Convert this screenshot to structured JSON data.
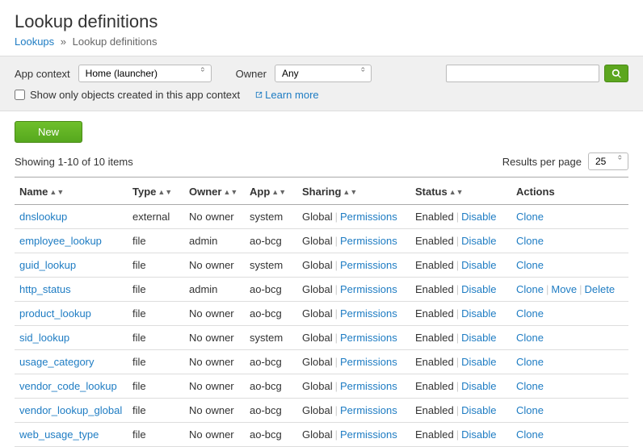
{
  "header": {
    "title": "Lookup definitions",
    "breadcrumb_link": "Lookups",
    "breadcrumb_sep": "»",
    "breadcrumb_current": "Lookup definitions"
  },
  "filterbar": {
    "app_context_label": "App context",
    "app_context_value": "Home (launcher)",
    "owner_label": "Owner",
    "owner_value": "Any",
    "search_placeholder": "",
    "checkbox_label": "Show only objects created in this app context",
    "learn_more": "Learn more"
  },
  "toolbar": {
    "new_label": "New"
  },
  "pager": {
    "showing": "Showing 1-10 of 10 items",
    "rpp_label": "Results per page",
    "rpp_value": "25"
  },
  "columns": {
    "name": "Name",
    "type": "Type",
    "owner": "Owner",
    "app": "App",
    "sharing": "Sharing",
    "status": "Status",
    "actions": "Actions"
  },
  "labels": {
    "permissions": "Permissions",
    "disable": "Disable",
    "clone": "Clone",
    "move": "Move",
    "delete": "Delete"
  },
  "rows": [
    {
      "name": "dnslookup",
      "type": "external",
      "owner": "No owner",
      "app": "system",
      "sharing": "Global",
      "status": "Enabled",
      "actions": [
        "clone"
      ]
    },
    {
      "name": "employee_lookup",
      "type": "file",
      "owner": "admin",
      "app": "ao-bcg",
      "sharing": "Global",
      "status": "Enabled",
      "actions": [
        "clone"
      ]
    },
    {
      "name": "guid_lookup",
      "type": "file",
      "owner": "No owner",
      "app": "system",
      "sharing": "Global",
      "status": "Enabled",
      "actions": [
        "clone"
      ]
    },
    {
      "name": "http_status",
      "type": "file",
      "owner": "admin",
      "app": "ao-bcg",
      "sharing": "Global",
      "status": "Enabled",
      "actions": [
        "clone",
        "move",
        "delete"
      ]
    },
    {
      "name": "product_lookup",
      "type": "file",
      "owner": "No owner",
      "app": "ao-bcg",
      "sharing": "Global",
      "status": "Enabled",
      "actions": [
        "clone"
      ]
    },
    {
      "name": "sid_lookup",
      "type": "file",
      "owner": "No owner",
      "app": "system",
      "sharing": "Global",
      "status": "Enabled",
      "actions": [
        "clone"
      ]
    },
    {
      "name": "usage_category",
      "type": "file",
      "owner": "No owner",
      "app": "ao-bcg",
      "sharing": "Global",
      "status": "Enabled",
      "actions": [
        "clone"
      ]
    },
    {
      "name": "vendor_code_lookup",
      "type": "file",
      "owner": "No owner",
      "app": "ao-bcg",
      "sharing": "Global",
      "status": "Enabled",
      "actions": [
        "clone"
      ]
    },
    {
      "name": "vendor_lookup_global",
      "type": "file",
      "owner": "No owner",
      "app": "ao-bcg",
      "sharing": "Global",
      "status": "Enabled",
      "actions": [
        "clone"
      ]
    },
    {
      "name": "web_usage_type",
      "type": "file",
      "owner": "No owner",
      "app": "ao-bcg",
      "sharing": "Global",
      "status": "Enabled",
      "actions": [
        "clone"
      ]
    }
  ]
}
